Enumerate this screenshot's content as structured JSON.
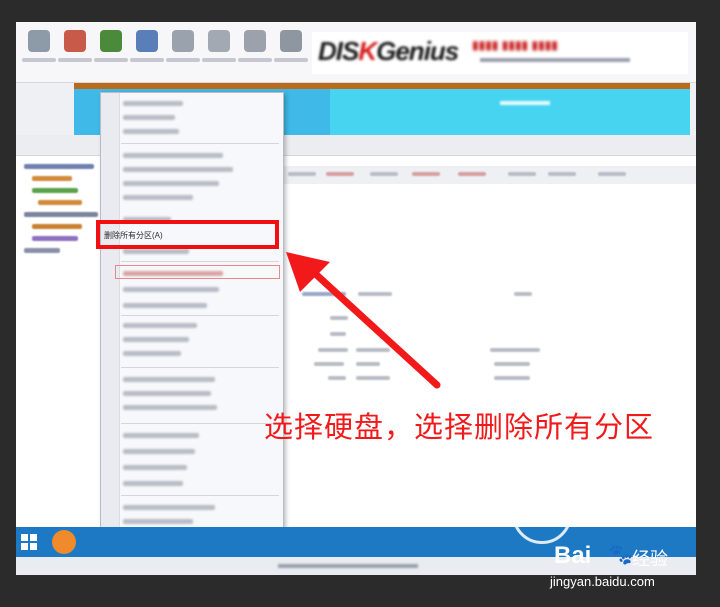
{
  "annotation": {
    "text": "选择硬盘，选择删除所有分区",
    "color": "#f2191b"
  },
  "context_menu": {
    "highlighted_item": "删除所有分区(A)"
  },
  "watermark": {
    "brand": "Bai",
    "brand_suffix": "经验",
    "paw_icon": "paw-icon",
    "url": "jingyan.baidu.com"
  },
  "colors": {
    "highlight_border": "#f20f12",
    "disk_bar": "#3fb9e7",
    "taskbar": "#1d79c4"
  }
}
